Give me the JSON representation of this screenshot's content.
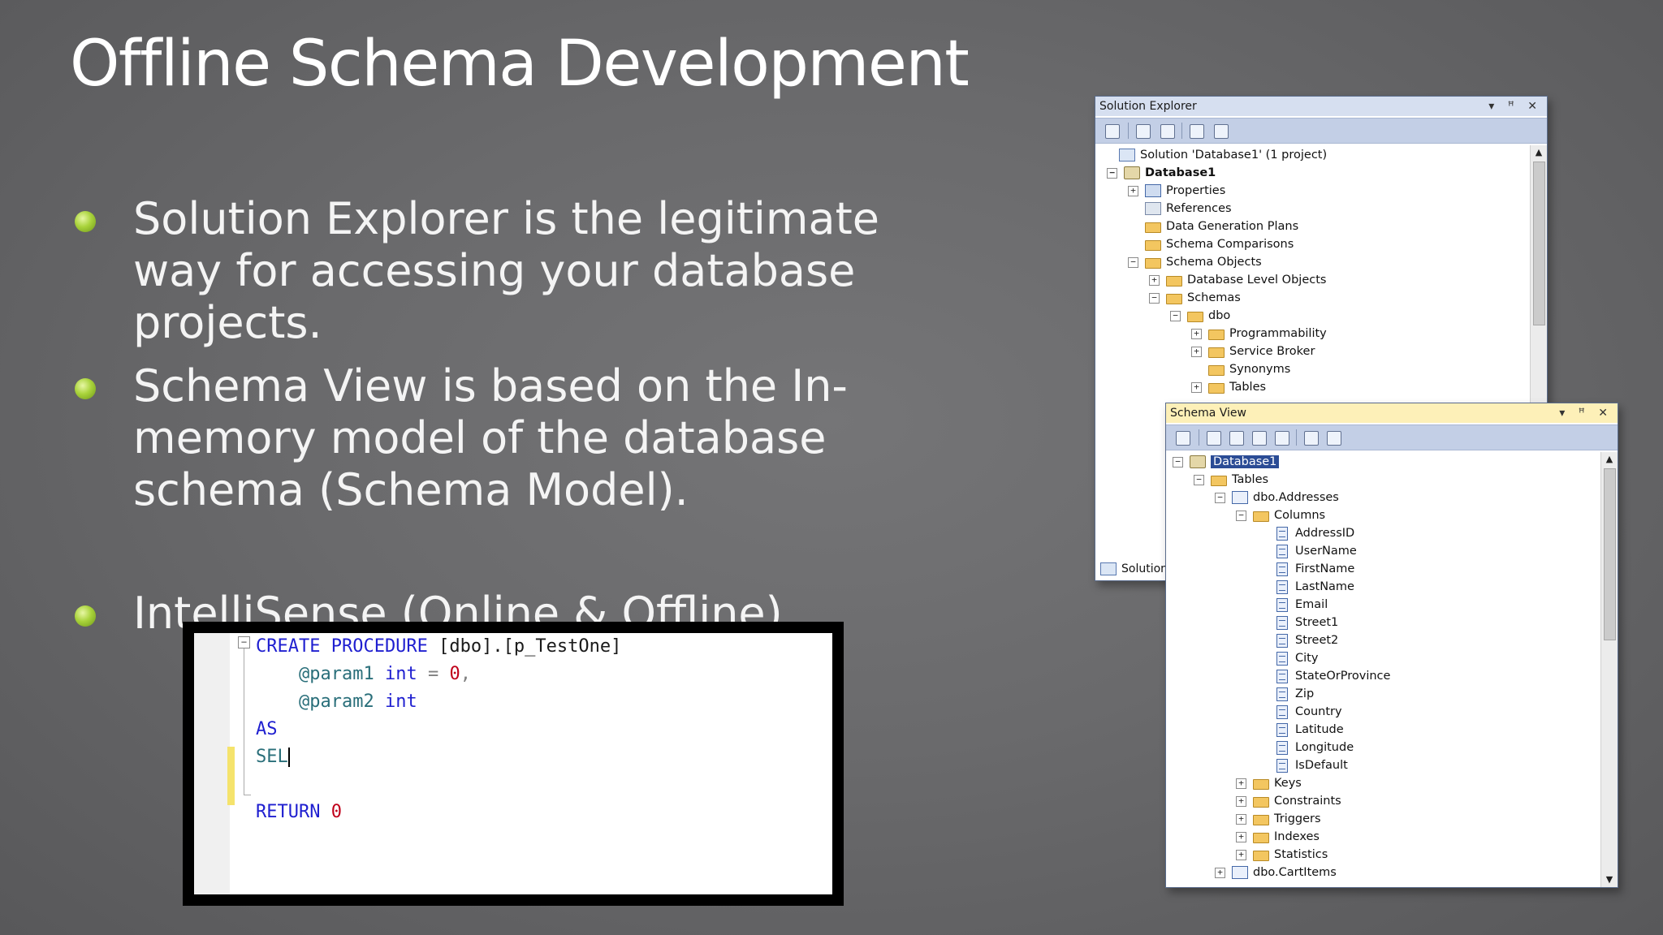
{
  "slide": {
    "title": "Offline Schema Development",
    "bullets": [
      "Solution Explorer is the legitimate way for accessing your database projects.",
      "Schema View is based on the In-memory model of the database schema (Schema Model).",
      "IntelliSense (Online & Offline)"
    ]
  },
  "code": {
    "line1": {
      "kw": "CREATE PROCEDURE",
      "obj": "[dbo].[p_TestOne]"
    },
    "line2": {
      "param": "@param1",
      "type": "int",
      "eq": "=",
      "val": "0",
      "comma": ","
    },
    "line3": {
      "param": "@param2",
      "type": "int"
    },
    "line4": "AS",
    "line5": "SEL",
    "line7": {
      "kw": "RETURN",
      "val": "0"
    }
  },
  "solution_explorer": {
    "title": "Solution Explorer",
    "window_buttons": "▾ ꟸ ✕",
    "bottom_tab": "Solution",
    "items": [
      {
        "label": "Solution 'Database1' (1 project)",
        "icon": "solution-icon"
      },
      {
        "label": "Database1",
        "icon": "database-project-icon"
      },
      {
        "label": "Properties",
        "icon": "properties-icon"
      },
      {
        "label": "References",
        "icon": "references-icon"
      },
      {
        "label": "Data Generation Plans",
        "icon": "folder-icon"
      },
      {
        "label": "Schema Comparisons",
        "icon": "folder-icon"
      },
      {
        "label": "Schema Objects",
        "icon": "folder-icon"
      },
      {
        "label": "Database Level Objects",
        "icon": "folder-icon"
      },
      {
        "label": "Schemas",
        "icon": "folder-icon"
      },
      {
        "label": "dbo",
        "icon": "folder-icon"
      },
      {
        "label": "Programmability",
        "icon": "folder-icon"
      },
      {
        "label": "Service Broker",
        "icon": "folder-icon"
      },
      {
        "label": "Synonyms",
        "icon": "folder-icon"
      },
      {
        "label": "Tables",
        "icon": "folder-icon"
      }
    ]
  },
  "schema_view": {
    "title": "Schema View",
    "window_buttons": "▾ ꟸ ✕",
    "items": [
      {
        "label": "Database1",
        "icon": "database-icon"
      },
      {
        "label": "Tables",
        "icon": "folder-icon"
      },
      {
        "label": "dbo.Addresses",
        "icon": "table-icon"
      },
      {
        "label": "Columns",
        "icon": "folder-icon"
      },
      {
        "label": "AddressID",
        "icon": "column-icon"
      },
      {
        "label": "UserName",
        "icon": "column-icon"
      },
      {
        "label": "FirstName",
        "icon": "column-icon"
      },
      {
        "label": "LastName",
        "icon": "column-icon"
      },
      {
        "label": "Email",
        "icon": "column-icon"
      },
      {
        "label": "Street1",
        "icon": "column-icon"
      },
      {
        "label": "Street2",
        "icon": "column-icon"
      },
      {
        "label": "City",
        "icon": "column-icon"
      },
      {
        "label": "StateOrProvince",
        "icon": "column-icon"
      },
      {
        "label": "Zip",
        "icon": "column-icon"
      },
      {
        "label": "Country",
        "icon": "column-icon"
      },
      {
        "label": "Latitude",
        "icon": "column-icon"
      },
      {
        "label": "Longitude",
        "icon": "column-icon"
      },
      {
        "label": "IsDefault",
        "icon": "column-icon"
      },
      {
        "label": "Keys",
        "icon": "folder-icon"
      },
      {
        "label": "Constraints",
        "icon": "folder-icon"
      },
      {
        "label": "Triggers",
        "icon": "folder-icon"
      },
      {
        "label": "Indexes",
        "icon": "folder-icon"
      },
      {
        "label": "Statistics",
        "icon": "folder-icon"
      },
      {
        "label": "dbo.CartItems",
        "icon": "table-icon"
      }
    ]
  },
  "colors": {
    "bullet": "#a9d33b",
    "keyword": "#1f1fd0",
    "number": "#c0001a",
    "selection": "#2b4c95"
  }
}
